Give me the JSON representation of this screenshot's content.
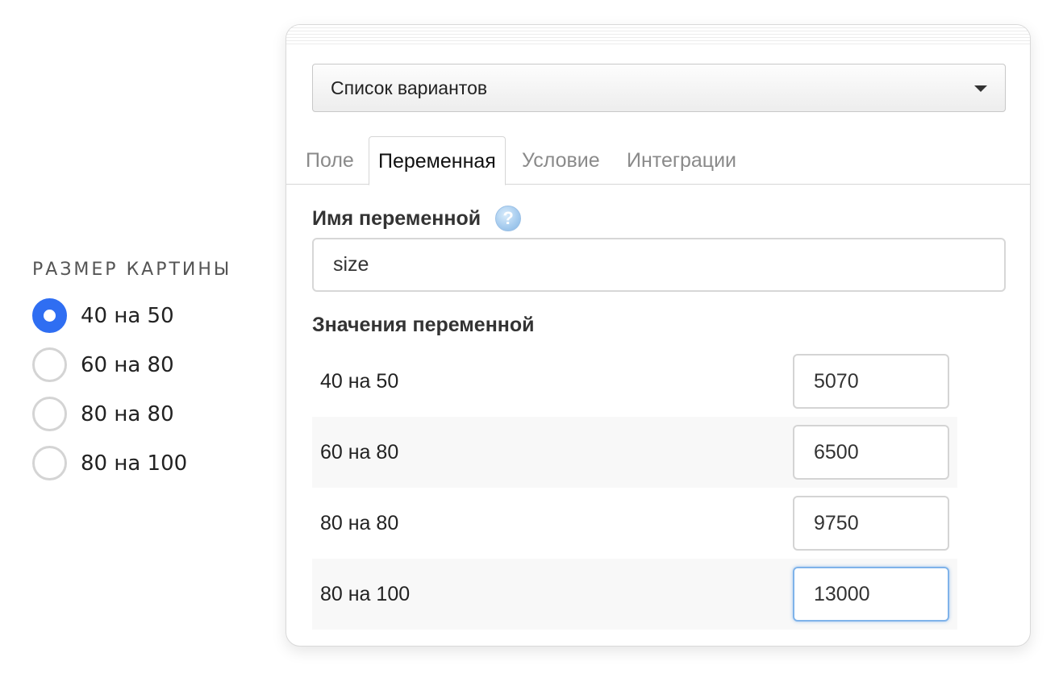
{
  "preview": {
    "title": "РАЗМЕР КАРТИНЫ",
    "options": [
      {
        "label": "40 на 50",
        "checked": true
      },
      {
        "label": "60 на 80",
        "checked": false
      },
      {
        "label": "80 на 80",
        "checked": false
      },
      {
        "label": "80 на 100",
        "checked": false
      }
    ]
  },
  "editor": {
    "field_type": {
      "value": "Список вариантов",
      "icon": "caret-down-icon"
    },
    "tabs": [
      {
        "label": "Поле",
        "active": false
      },
      {
        "label": "Переменная",
        "active": true
      },
      {
        "label": "Условие",
        "active": false
      },
      {
        "label": "Интеграции",
        "active": false
      }
    ],
    "variable_name": {
      "label": "Имя переменной",
      "help_icon": "?",
      "value": "size"
    },
    "variable_values": {
      "label": "Значения переменной",
      "rows": [
        {
          "name": "40 на 50",
          "value": "5070"
        },
        {
          "name": "60 на 80",
          "value": "6500"
        },
        {
          "name": "80 на 80",
          "value": "9750"
        },
        {
          "name": "80 на 100",
          "value": "13000",
          "focused": true
        }
      ]
    },
    "colors": {
      "accent": "#2f6ef2",
      "focus_border": "#7fb3ea",
      "row_alt": "#f8f8f8"
    }
  }
}
